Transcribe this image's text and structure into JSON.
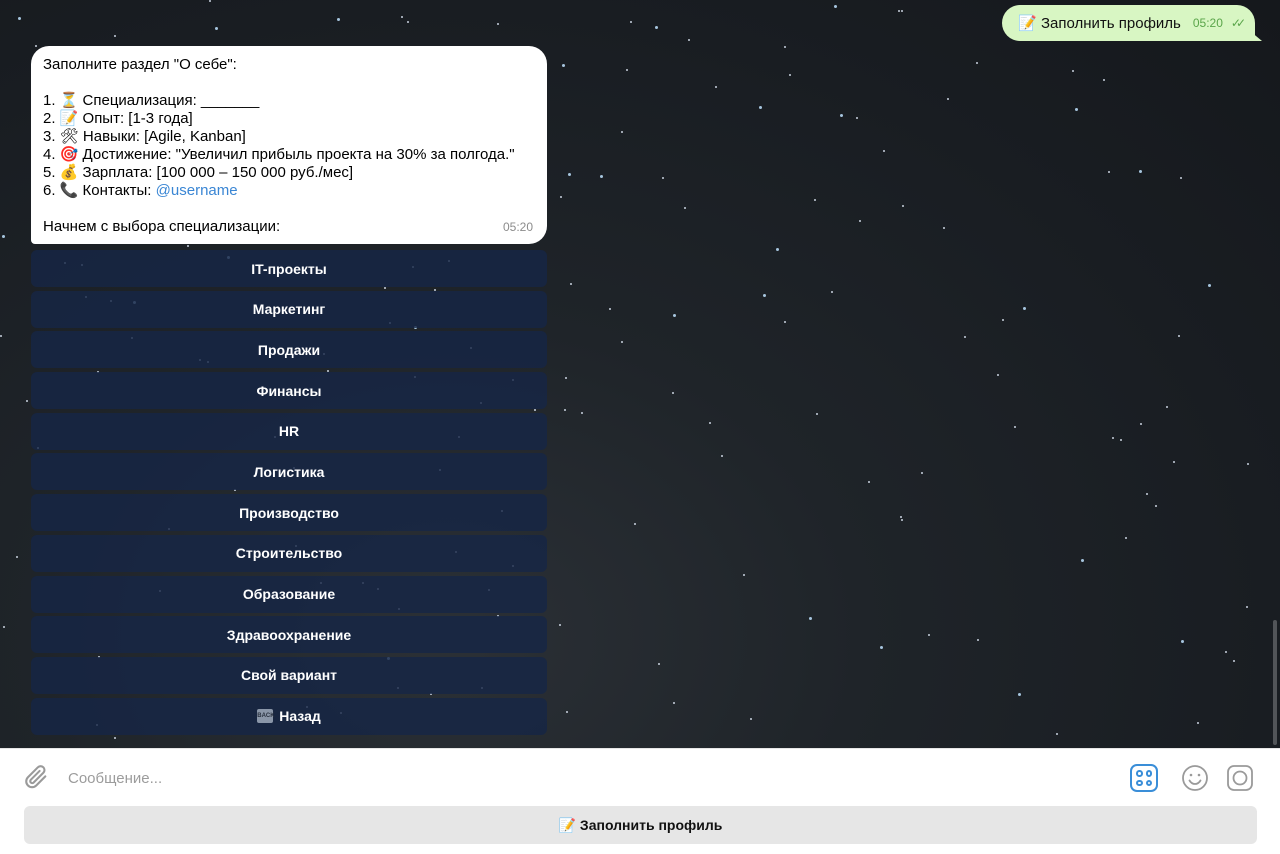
{
  "outgoing_message": {
    "text": "📝 Заполнить профиль",
    "time": "05:20",
    "status": "✓✓"
  },
  "bot_message": {
    "lines": [
      "Заполните раздел \"О себе\":",
      "",
      "1. ⏳ Специализация: _______",
      "2. 📝 Опыт: [1-3 года]",
      "3. 🛠 Навыки: [Agile, Kanban]",
      "4. 🎯 Достижение: \"Увеличил прибыль проекта на 30% за полгода.\"",
      "5. 💰 Зарплата: [100 000 – 150 000 руб./мес]",
      "6. 📞 Контакты: ",
      "",
      "Начнем с выбора специализации:"
    ],
    "contact_link": "@username",
    "time": "05:20"
  },
  "inline_keyboard": [
    "IT-проекты",
    "Маркетинг",
    "Продажи",
    "Финансы",
    "HR",
    "Логистика",
    "Производство",
    "Строительство",
    "Образование",
    "Здравоохранение",
    "Свой вариант"
  ],
  "back_button": {
    "icon": "BACK",
    "label": "Назад"
  },
  "composer": {
    "placeholder": "Сообщение...",
    "reply_button": "📝 Заполнить профиль"
  },
  "colors": {
    "accent": "#3a8ed8",
    "outgoing_bubble": "#d8f6c3",
    "keyboard_button": "#162646"
  }
}
